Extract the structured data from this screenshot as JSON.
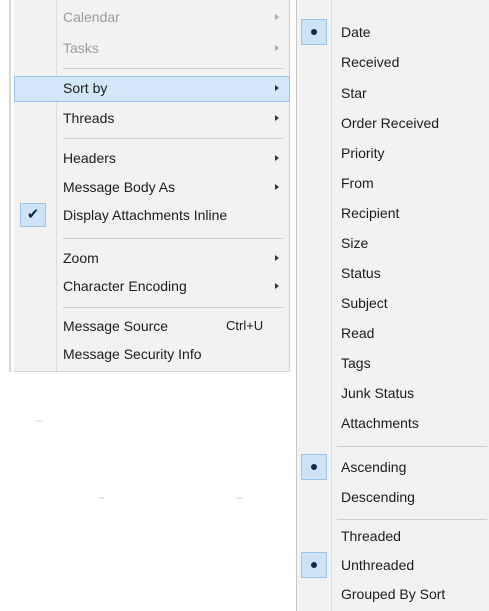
{
  "main_menu": {
    "items": [
      {
        "label": "Calendar",
        "disabled": true,
        "has_submenu": true
      },
      {
        "label": "Tasks",
        "disabled": true,
        "has_submenu": true
      },
      {
        "label": "Sort by",
        "highlighted": true,
        "has_submenu": true
      },
      {
        "label": "Threads",
        "has_submenu": true
      },
      {
        "label": "Headers",
        "has_submenu": true
      },
      {
        "label": "Message Body As",
        "has_submenu": true
      },
      {
        "label": "Display Attachments Inline",
        "checked": true
      },
      {
        "label": "Zoom",
        "has_submenu": true
      },
      {
        "label": "Character Encoding",
        "has_submenu": true
      },
      {
        "label": "Message Source",
        "shortcut": "Ctrl+U"
      },
      {
        "label": "Message Security Info"
      }
    ],
    "check_glyph": "✔"
  },
  "sort_submenu": {
    "sort_fields": [
      {
        "label": "Date",
        "selected": true
      },
      {
        "label": "Received"
      },
      {
        "label": "Star"
      },
      {
        "label": "Order Received"
      },
      {
        "label": "Priority"
      },
      {
        "label": "From"
      },
      {
        "label": "Recipient"
      },
      {
        "label": "Size"
      },
      {
        "label": "Status"
      },
      {
        "label": "Subject"
      },
      {
        "label": "Read"
      },
      {
        "label": "Tags"
      },
      {
        "label": "Junk Status"
      },
      {
        "label": "Attachments"
      }
    ],
    "order": [
      {
        "label": "Ascending",
        "selected": true
      },
      {
        "label": "Descending"
      }
    ],
    "threading": [
      {
        "label": "Threaded"
      },
      {
        "label": "Unthreaded",
        "selected": true
      },
      {
        "label": "Grouped By Sort"
      }
    ]
  },
  "colors": {
    "menu_bg": "#f2f2f2",
    "highlight_bg": "#d4e6fa",
    "highlight_border": "#9cc3ea",
    "disabled_text": "#9c9c9c",
    "text": "#1c1c1c"
  }
}
